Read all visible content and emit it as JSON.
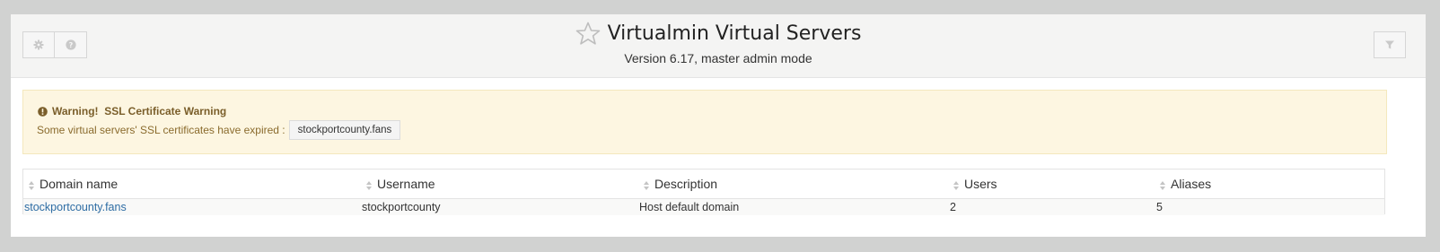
{
  "header": {
    "title": "Virtualmin Virtual Servers",
    "subtitle": "Version 6.17, master admin mode",
    "buttons": [
      {
        "icon": "gear-icon"
      },
      {
        "icon": "question-icon"
      }
    ],
    "filter_icon": "filter-icon",
    "favorite_icon": "star-icon"
  },
  "alert": {
    "heading": "Warning!  SSL Certificate Warning",
    "message": "Some virtual servers' SSL certificates have expired :",
    "domains": [
      "stockportcounty.fans"
    ],
    "icon": "exclamation-circle-icon"
  },
  "table": {
    "columns": [
      "Domain name",
      "Username",
      "Description",
      "Users",
      "Aliases"
    ],
    "rows": [
      [
        "stockportcounty.fans",
        "stockportcounty",
        "Host default domain",
        "2",
        "5"
      ]
    ]
  },
  "colors": {
    "alert_bg": "#fdf6e1",
    "alert_text": "#8a6b2d",
    "link": "#2e6da4"
  }
}
